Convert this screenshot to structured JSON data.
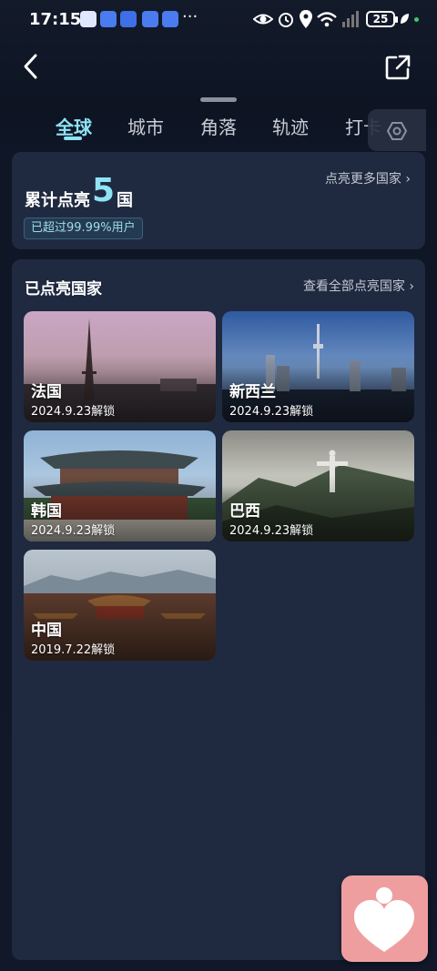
{
  "status_bar": {
    "time": "17:15",
    "more": "···",
    "battery": "25"
  },
  "header": {
    "tabs": [
      {
        "label": "全球",
        "active": true
      },
      {
        "label": "城市",
        "active": false
      },
      {
        "label": "角落",
        "active": false
      },
      {
        "label": "轨迹",
        "active": false
      },
      {
        "label": "打卡",
        "active": false
      }
    ]
  },
  "summary": {
    "prefix": "累计点亮",
    "count": "5",
    "unit": "国",
    "more_link": "点亮更多国家 ›",
    "badge": "已超过99.99%用户"
  },
  "visited": {
    "title": "已点亮国家",
    "view_all": "查看全部点亮国家 ›",
    "countries": [
      {
        "name": "法国",
        "date": "2024.9.23解锁"
      },
      {
        "name": "新西兰",
        "date": "2024.9.23解锁"
      },
      {
        "name": "韩国",
        "date": "2024.9.23解锁"
      },
      {
        "name": "巴西",
        "date": "2024.9.23解锁"
      },
      {
        "name": "中国",
        "date": "2019.7.22解锁"
      }
    ]
  },
  "colors": {
    "accent": "#8fe3f5",
    "card": "#1f2a40",
    "background": "#0f1626",
    "float_button": "#ef9ea0"
  }
}
